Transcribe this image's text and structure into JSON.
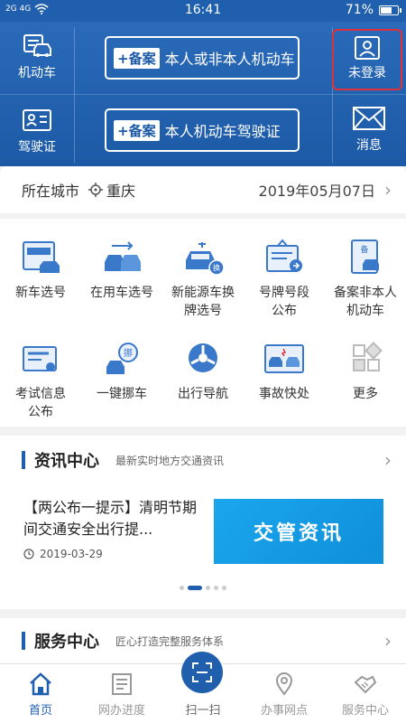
{
  "status_bar": {
    "signal_text": "2G 4G",
    "time": "16:41",
    "battery": "71%",
    "battery_level": 0.71
  },
  "header": {
    "vehicle_label": "机动车",
    "license_label": "驾驶证",
    "banner1": {
      "tag": "+备案",
      "text": "本人或非本人机动车"
    },
    "banner2": {
      "tag": "+备案",
      "text": "本人机动车驾驶证"
    },
    "login_label": "未登录",
    "message_label": "消息"
  },
  "city": {
    "label": "所在城市",
    "name": "重庆",
    "date": "2019年05月07日"
  },
  "services": [
    {
      "label": "新车选号",
      "icon": "new-plate-icon"
    },
    {
      "label": "在用车选号",
      "icon": "used-car-plate-icon"
    },
    {
      "label": "新能源车换牌选号",
      "icon": "ev-swap-icon"
    },
    {
      "label": "号牌号段公布",
      "icon": "plate-range-icon"
    },
    {
      "label": "备案非本人机动车",
      "icon": "record-vehicle-icon"
    },
    {
      "label": "考试信息公布",
      "icon": "exam-info-icon"
    },
    {
      "label": "一键挪车",
      "icon": "move-car-icon"
    },
    {
      "label": "出行导航",
      "icon": "navigation-icon"
    },
    {
      "label": "事故快处",
      "icon": "accident-icon"
    },
    {
      "label": "更多",
      "icon": "more-icon"
    }
  ],
  "news": {
    "title": "资讯中心",
    "subtitle": "最新实时地方交通资讯",
    "item_title": "【两公布一提示】清明节期间交通安全出行提...",
    "item_date": "2019-03-29",
    "image_text": "交管资讯"
  },
  "service_center": {
    "title": "服务中心",
    "subtitle": "匠心打造完整服务体系"
  },
  "nav": {
    "home": "首页",
    "progress": "网办进度",
    "scan": "扫一扫",
    "outlets": "办事网点",
    "service": "服务中心"
  },
  "colors": {
    "brand": "#1f5fae",
    "accent_red": "#e0303a",
    "news_blue": "#1aa6ee"
  }
}
